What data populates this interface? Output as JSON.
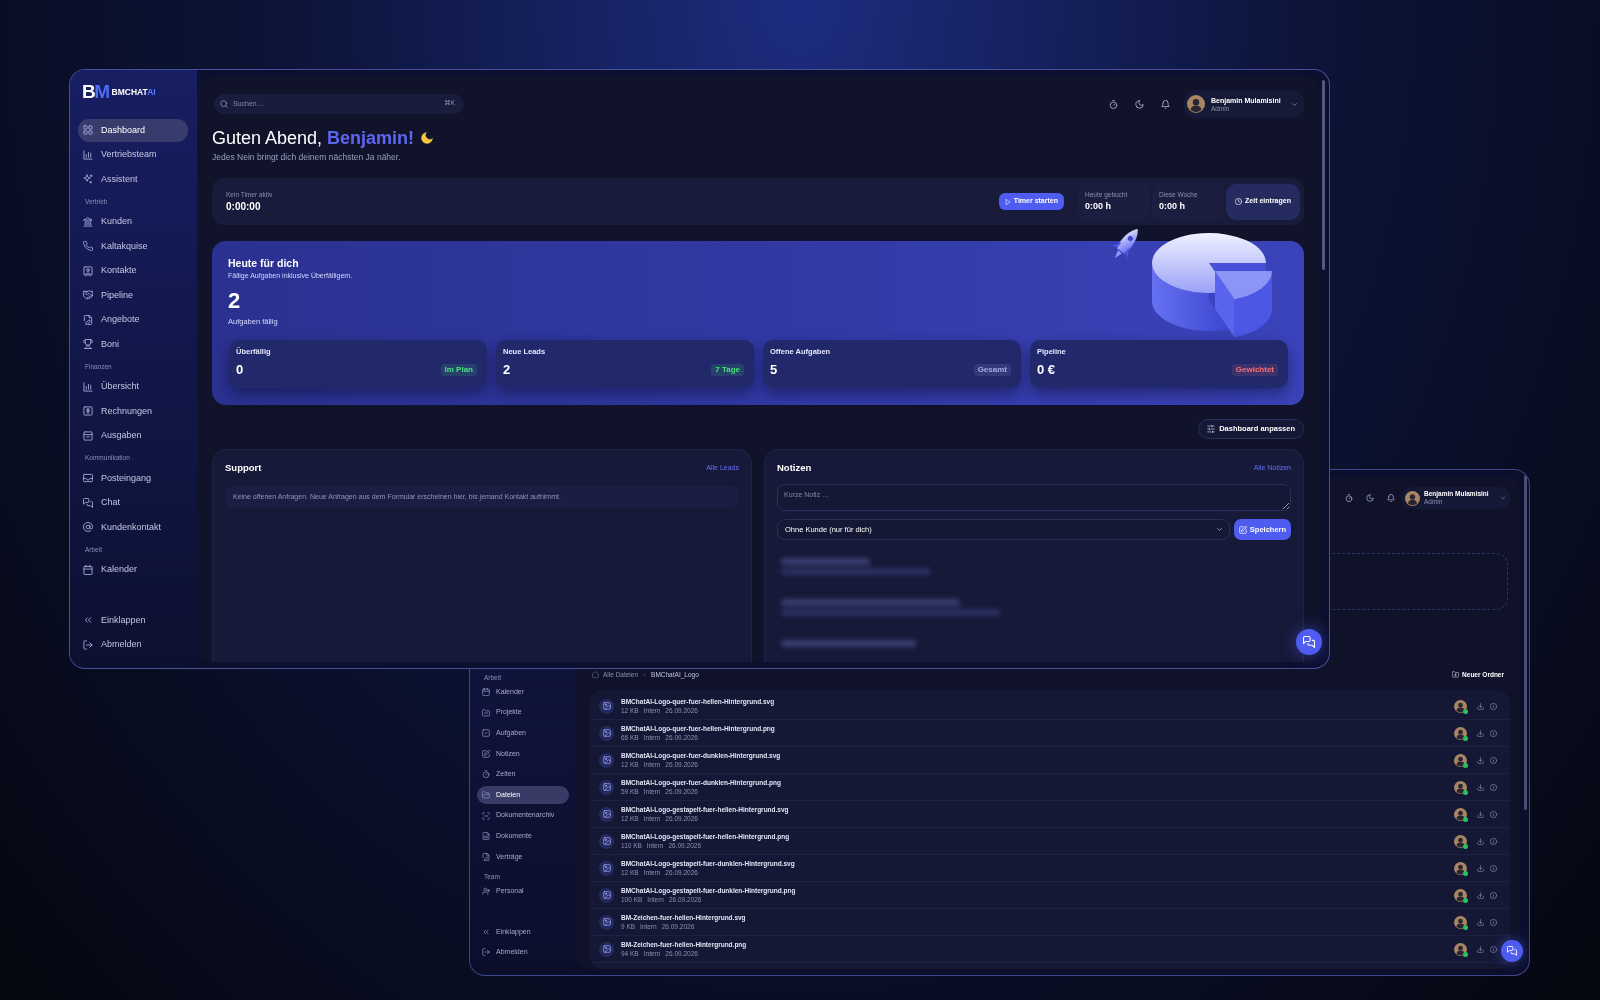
{
  "main_window": {
    "logo": {
      "mark": [
        "B",
        "M"
      ],
      "wordmark": "BMCHAT",
      "wordmark_accent": "AI"
    },
    "sidebar": {
      "sections": [
        {
          "items": [
            {
              "label": "Dashboard",
              "selected": true
            },
            {
              "label": "Vertriebsteam",
              "selected": false
            },
            {
              "label": "Assistent",
              "selected": false
            }
          ]
        },
        {
          "title": "Vertrieb",
          "items": [
            {
              "label": "Kunden",
              "selected": false
            },
            {
              "label": "Kaltakquise",
              "selected": false
            },
            {
              "label": "Kontakte",
              "selected": false
            },
            {
              "label": "Pipeline",
              "selected": false
            },
            {
              "label": "Angebote",
              "selected": false
            },
            {
              "label": "Boni",
              "selected": false
            }
          ]
        },
        {
          "title": "Finanzen",
          "items": [
            {
              "label": "Übersicht",
              "selected": false
            },
            {
              "label": "Rechnungen",
              "selected": false
            },
            {
              "label": "Ausgaben",
              "selected": false
            }
          ]
        },
        {
          "title": "Kommunikation",
          "items": [
            {
              "label": "Posteingang",
              "selected": false
            },
            {
              "label": "Chat",
              "selected": false
            },
            {
              "label": "Kundenkontakt",
              "selected": false
            }
          ]
        },
        {
          "title": "Arbeit",
          "items": [
            {
              "label": "Kalender",
              "selected": false
            }
          ]
        }
      ],
      "footer": [
        {
          "label": "Einklappen"
        },
        {
          "label": "Abmelden"
        }
      ]
    },
    "search": {
      "placeholder": "Suchen…",
      "shortcut": "⌘K"
    },
    "user": {
      "name": "Benjamin Mulamisini",
      "role": "Admin"
    },
    "greeting": {
      "text": "Guten Abend,",
      "name": "Benjamin!"
    },
    "subtitle": "Jedes Nein bringt dich deinem nächsten Ja näher.",
    "timer": {
      "status": "Kein Timer aktiv",
      "time": "0:00:00",
      "start_button": "Timer starten",
      "totals": [
        {
          "label": "Heute gebucht",
          "value": "0:00 h"
        },
        {
          "label": "Diese Woche",
          "value": "0:00 h"
        }
      ],
      "log_button": "Zeit eintragen"
    },
    "today": {
      "title": "Heute für dich",
      "subtitle": "Fällige Aufgaben inklusive Überfälligem.",
      "count": "2",
      "count_label": "Aufgaben fällig",
      "stats": [
        {
          "label": "Überfällig",
          "value": "0",
          "badge": {
            "text": "Im Plan",
            "color": "#4ade80"
          }
        },
        {
          "label": "Neue Leads",
          "value": "2",
          "badge": {
            "text": "7 Tage",
            "color": "#4ade80"
          }
        },
        {
          "label": "Offene Aufgaben",
          "value": "5",
          "badge": {
            "text": "Gesamt",
            "color": "#a5a9e0"
          }
        },
        {
          "label": "Pipeline",
          "value": "0 €",
          "badge": {
            "text": "Gewichtet",
            "color": "#f87171"
          }
        }
      ]
    },
    "customize_button": "Dashboard anpassen",
    "support": {
      "title": "Support",
      "link": "Alle Leads",
      "empty_message": "Keine offenen Anfragen. Neue Anfragen aus dem Formular erscheinen hier, bis jemand Kontakt aufnimmt."
    },
    "notes": {
      "title": "Notizen",
      "link": "Alle Notizen",
      "input": {
        "placeholder": "Kurze Notiz …"
      },
      "customer_select": {
        "value": "Ohne Kunde (nur für dich)"
      },
      "save_button": "Speichern"
    }
  },
  "files_window": {
    "user": {
      "name": "Benjamin Mulamisini",
      "role": "Admin"
    },
    "sidebar": {
      "sections": [
        {
          "title": "Arbeit",
          "items": [
            {
              "label": "Kalender",
              "selected": false
            },
            {
              "label": "Projekte",
              "selected": false
            },
            {
              "label": "Aufgaben",
              "selected": false
            },
            {
              "label": "Notizen",
              "selected": false
            },
            {
              "label": "Zeiten",
              "selected": false
            },
            {
              "label": "Dateien",
              "selected": true
            },
            {
              "label": "Dokumentenarchiv",
              "selected": false
            },
            {
              "label": "Dokumente",
              "selected": false
            },
            {
              "label": "Verträge",
              "selected": false
            }
          ]
        },
        {
          "title": "Team",
          "items": [
            {
              "label": "Personal",
              "selected": false
            }
          ]
        }
      ],
      "footer": [
        {
          "label": "Einklappen"
        },
        {
          "label": "Abmelden"
        }
      ]
    },
    "breadcrumb": [
      {
        "label": "Alle Dateien"
      },
      {
        "label": "BMChatAI_Logo"
      }
    ],
    "new_folder_button": "Neuer Ordner",
    "files": [
      {
        "name": "BMChatAI-Logo-quer-fuer-hellen-Hintergrund.svg",
        "size": "12 KB",
        "visibility": "Intern",
        "date": "26.09.2026",
        "owner_online": true
      },
      {
        "name": "BMChatAI-Logo-quer-fuer-hellen-Hintergrund.png",
        "size": "66 KB",
        "visibility": "Intern",
        "date": "26.09.2026",
        "owner_online": true
      },
      {
        "name": "BMChatAI-Logo-quer-fuer-dunklen-Hintergrund.svg",
        "size": "12 KB",
        "visibility": "Intern",
        "date": "26.09.2026",
        "owner_online": true
      },
      {
        "name": "BMChatAI-Logo-quer-fuer-dunklen-Hintergrund.png",
        "size": "59 KB",
        "visibility": "Intern",
        "date": "26.09.2026",
        "owner_online": true
      },
      {
        "name": "BMChatAI-Logo-gestapelt-fuer-hellen-Hintergrund.svg",
        "size": "12 KB",
        "visibility": "Intern",
        "date": "26.09.2026",
        "owner_online": true
      },
      {
        "name": "BMChatAI-Logo-gestapelt-fuer-hellen-Hintergrund.png",
        "size": "110 KB",
        "visibility": "Intern",
        "date": "26.09.2026",
        "owner_online": true
      },
      {
        "name": "BMChatAI-Logo-gestapelt-fuer-dunklen-Hintergrund.svg",
        "size": "12 KB",
        "visibility": "Intern",
        "date": "26.09.2026",
        "owner_online": true
      },
      {
        "name": "BMChatAI-Logo-gestapelt-fuer-dunklen-Hintergrund.png",
        "size": "100 KB",
        "visibility": "Intern",
        "date": "26.09.2026",
        "owner_online": true
      },
      {
        "name": "BM-Zeichen-fuer-hellen-Hintergrund.svg",
        "size": "9 KB",
        "visibility": "Intern",
        "date": "26.09.2026",
        "owner_online": true
      },
      {
        "name": "BM-Zeichen-fuer-hellen-Hintergrund.png",
        "size": "94 KB",
        "visibility": "Intern",
        "date": "26.09.2026",
        "owner_online": true
      }
    ]
  }
}
